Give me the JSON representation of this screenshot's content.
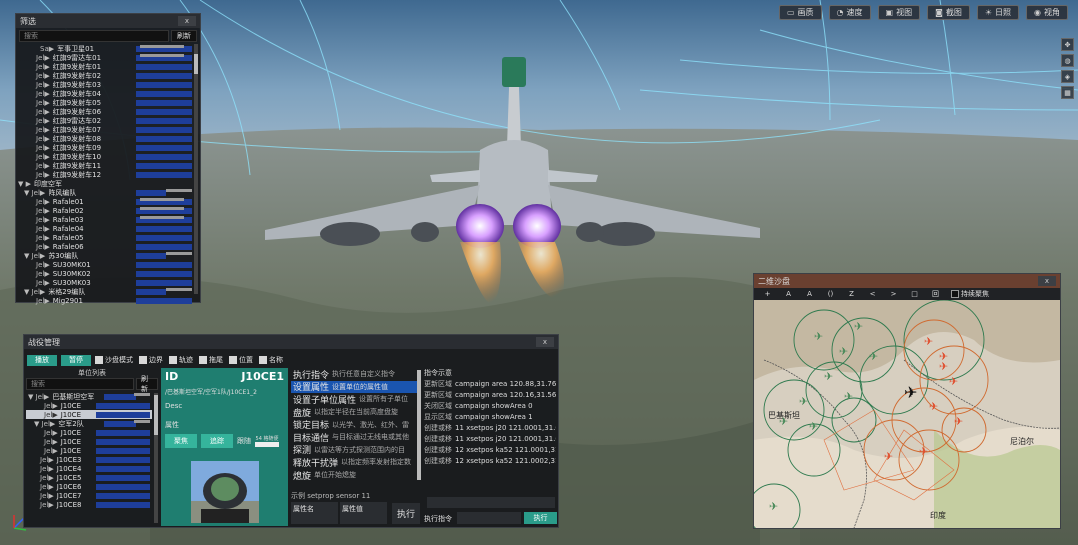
{
  "toolbar": {
    "buttons": [
      {
        "label": "画质",
        "icon": "display-icon"
      },
      {
        "label": "速度",
        "icon": "gauge-icon"
      },
      {
        "label": "视图",
        "icon": "view-icon"
      },
      {
        "label": "截图",
        "icon": "camera-icon"
      },
      {
        "label": "日照",
        "icon": "sun-icon"
      },
      {
        "label": "视角",
        "icon": "eye-icon"
      }
    ]
  },
  "side_icons": [
    "move-icon",
    "globe-icon",
    "compass-icon",
    "map-icon"
  ],
  "filter_panel": {
    "title": "筛选",
    "close": "x",
    "search_placeholder": "搜索",
    "refresh": "刷新",
    "rows": [
      {
        "tag": "Sa▶",
        "name": "军事卫星01",
        "indent": 24
      },
      {
        "tag": "Jel▶",
        "name": "红旗9雷达车01",
        "indent": 20
      },
      {
        "tag": "Jel▶",
        "name": "红旗9发射车01",
        "indent": 20
      },
      {
        "tag": "Jel▶",
        "name": "红旗9发射车02",
        "indent": 20
      },
      {
        "tag": "Jel▶",
        "name": "红旗9发射车03",
        "indent": 20
      },
      {
        "tag": "Jel▶",
        "name": "红旗9发射车04",
        "indent": 20
      },
      {
        "tag": "Jel▶",
        "name": "红旗9发射车05",
        "indent": 20
      },
      {
        "tag": "Jel▶",
        "name": "红旗9发射车06",
        "indent": 20
      },
      {
        "tag": "Jel▶",
        "name": "红旗9雷达车02",
        "indent": 20
      },
      {
        "tag": "Jel▶",
        "name": "红旗9发射车07",
        "indent": 20
      },
      {
        "tag": "Jel▶",
        "name": "红旗9发射车08",
        "indent": 20
      },
      {
        "tag": "Jel▶",
        "name": "红旗9发射车09",
        "indent": 20
      },
      {
        "tag": "Jel▶",
        "name": "红旗9发射车10",
        "indent": 20
      },
      {
        "tag": "Jel▶",
        "name": "红旗9发射车11",
        "indent": 20
      },
      {
        "tag": "Jel▶",
        "name": "红旗9发射车12",
        "indent": 20
      },
      {
        "tag": "▼ ▶",
        "name": "印度空军",
        "indent": 2
      },
      {
        "tag": "▼ Jel▶",
        "name": "阵风编队",
        "indent": 8
      },
      {
        "tag": "Jel▶",
        "name": "Rafale01",
        "indent": 20
      },
      {
        "tag": "Jel▶",
        "name": "Rafale02",
        "indent": 20
      },
      {
        "tag": "Jel▶",
        "name": "Rafale03",
        "indent": 20
      },
      {
        "tag": "Jel▶",
        "name": "Rafale04",
        "indent": 20
      },
      {
        "tag": "Jel▶",
        "name": "Rafale05",
        "indent": 20
      },
      {
        "tag": "Jel▶",
        "name": "Rafale06",
        "indent": 20
      },
      {
        "tag": "▼ Jel▶",
        "name": "苏30编队",
        "indent": 8
      },
      {
        "tag": "Jel▶",
        "name": "SU30MK01",
        "indent": 20
      },
      {
        "tag": "Jel▶",
        "name": "SU30MK02",
        "indent": 20
      },
      {
        "tag": "Jel▶",
        "name": "SU30MK03",
        "indent": 20
      },
      {
        "tag": "▼ Jel▶",
        "name": "米格29编队",
        "indent": 8
      },
      {
        "tag": "Jel▶",
        "name": "Mig2901",
        "indent": 20
      }
    ]
  },
  "battle_panel": {
    "title": "战役管理",
    "close": "x",
    "play": "播放",
    "pause": "暂停",
    "checkboxes": [
      "沙盘模式",
      "边界",
      "轨迹",
      "拖尾",
      "位置",
      "名称"
    ],
    "unit_list_title": "单位列表",
    "search_placeholder": "搜索",
    "refresh": "刷新",
    "units": [
      {
        "tag": "▼ Jel▶",
        "name": "巴基斯坦空军",
        "indent": 2
      },
      {
        "tag": "Jel▶",
        "name": "J10CE",
        "indent": 18
      },
      {
        "tag": "Jel▶",
        "name": "J10CE",
        "indent": 18,
        "selected": true
      },
      {
        "tag": "▼ Jel▶",
        "name": "空军2队",
        "indent": 8
      },
      {
        "tag": "Jel▶",
        "name": "J10CE",
        "indent": 18
      },
      {
        "tag": "Jel▶",
        "name": "J10CE",
        "indent": 18
      },
      {
        "tag": "Jel▶",
        "name": "J10CE",
        "indent": 18
      },
      {
        "tag": "Jel▶",
        "name": "J10CE3",
        "indent": 14
      },
      {
        "tag": "Jel▶",
        "name": "J10CE4",
        "indent": 14
      },
      {
        "tag": "Jel▶",
        "name": "J10CE5",
        "indent": 14
      },
      {
        "tag": "Jel▶",
        "name": "J10CE6",
        "indent": 14
      },
      {
        "tag": "Jel▶",
        "name": "J10CE7",
        "indent": 14
      },
      {
        "tag": "Jel▶",
        "name": "J10CE8",
        "indent": 14
      }
    ],
    "detail": {
      "id_label": "ID",
      "id_value": "J10CE1",
      "path": "/巴基斯坦空军/空军1队/J10CE1_2",
      "desc": "Desc",
      "attr": "属性",
      "focus_btn": "聚焦",
      "track_btn": "追踪",
      "follow_label": "跟随",
      "follow_pos": "54 格随便"
    },
    "commands": [
      {
        "name": "执行指令",
        "desc": "执行任意自定义指令"
      },
      {
        "name": "设置属性",
        "desc": "设置单位的属性值",
        "selected": true
      },
      {
        "name": "设置子单位属性",
        "desc": "设置所有子单位"
      },
      {
        "name": "盘旋",
        "desc": "以指定半径在当前高度盘旋"
      },
      {
        "name": "锁定目标",
        "desc": "以光学、激光、红外、雷"
      },
      {
        "name": "目标通信",
        "desc": "与目标通过无线电或其他"
      },
      {
        "name": "探测",
        "desc": "以雷达等方式探测范围内的目"
      },
      {
        "name": "释放干扰弹",
        "desc": "以指定频率发射指定数"
      },
      {
        "name": "熄旋",
        "desc": "单位开始熄旋"
      }
    ],
    "example": "示例 setprop sensor 11",
    "attr_name": "属性名",
    "attr_value": "属性值",
    "exec": "执行",
    "log_title": "指令示意",
    "logs": [
      {
        "k": "更新区域",
        "v": "campaign area 120.88,31.76,"
      },
      {
        "k": "更新区域",
        "v": "campaign area 120.16,31.56,"
      },
      {
        "k": "关闭区域",
        "v": "campaign showArea 0"
      },
      {
        "k": "显示区域",
        "v": "campaign showArea 1"
      },
      {
        "k": "创建或移",
        "v": "11 xsetpos j20 121.0001,31.0"
      },
      {
        "k": "创建或移",
        "v": "11 xsetpos j20 121.0001,31.0"
      },
      {
        "k": "创建或移",
        "v": "12 xsetpos ka52 121.0001,31"
      },
      {
        "k": "创建或移",
        "v": "12 xsetpos ka52 121.0002,31"
      }
    ],
    "exec_cmd_label": "执行指令",
    "exec_btn": "执行"
  },
  "map_panel": {
    "title": "二维沙盘",
    "close": "x",
    "tools": [
      "+",
      "A",
      "A",
      "()",
      "Z",
      "<",
      ">",
      "□",
      "回"
    ],
    "keep_focus": "持续聚焦",
    "labels": {
      "pakistan": "巴基斯坦",
      "nepal": "尼泊尔",
      "india": "印度"
    }
  }
}
